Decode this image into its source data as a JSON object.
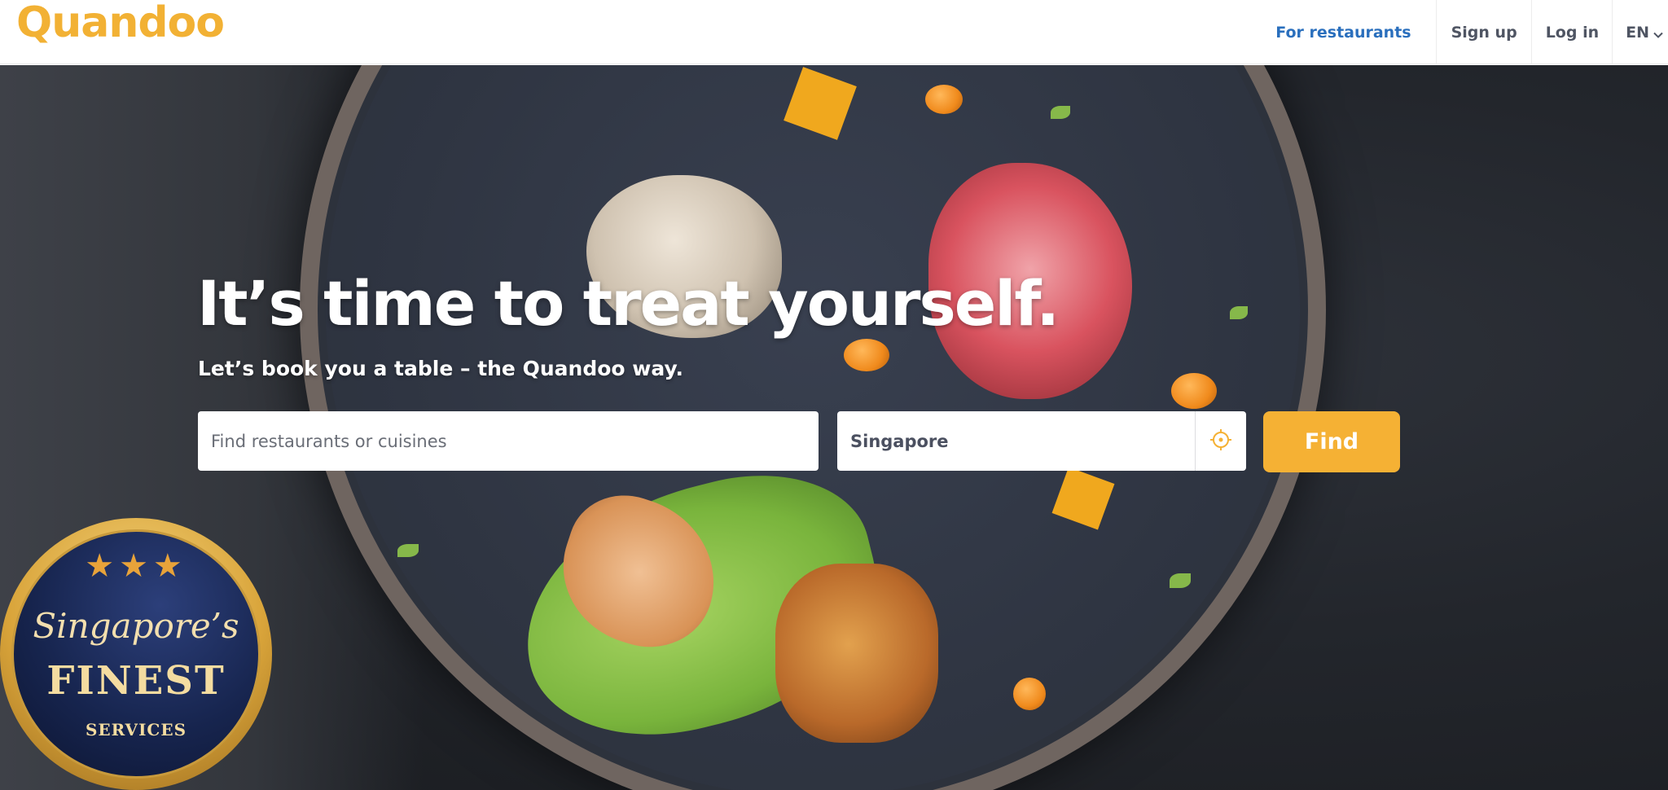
{
  "header": {
    "logo": "Quandoo",
    "nav": {
      "for_restaurants": "For restaurants",
      "sign_up": "Sign up",
      "log_in": "Log in",
      "language": "EN"
    }
  },
  "hero": {
    "title": "It’s time to treat yourself.",
    "subtitle": "Let’s book you a table – the Quandoo way.",
    "search": {
      "placeholder": "Find restaurants or cuisines",
      "value": ""
    },
    "location": {
      "value": "Singapore"
    },
    "find_label": "Find"
  },
  "badge": {
    "stars": "★★★",
    "script_text": "Singapore’s",
    "finest": "FINEST",
    "services": "SERVICES"
  },
  "colors": {
    "brand": "#f5b134",
    "link": "#2a6fbd"
  },
  "icons": {
    "locate": "crosshair-icon",
    "language_dropdown": "chevron-down-icon"
  }
}
